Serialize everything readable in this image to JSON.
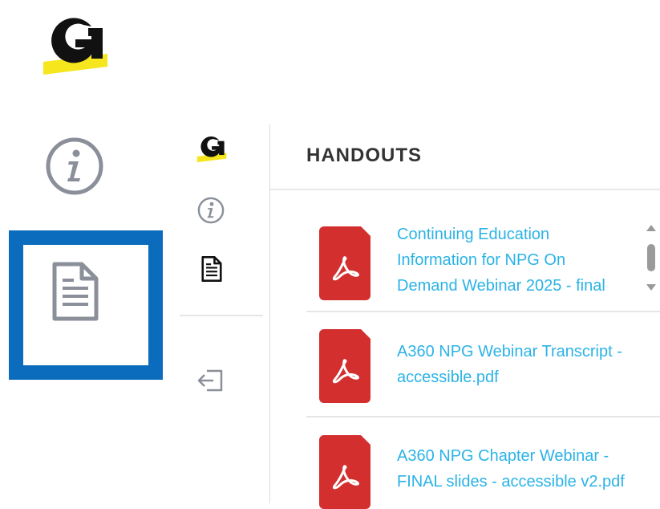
{
  "app": {
    "logo_letter": "G"
  },
  "sidebar": {
    "items": [
      {
        "name": "info",
        "icon": "info-icon"
      },
      {
        "name": "handouts",
        "icon": "document-icon",
        "selected": true
      }
    ],
    "highlight_color": "#0b6bbd"
  },
  "mini_nav": {
    "items": [
      {
        "icon": "logo"
      },
      {
        "icon": "info-icon"
      },
      {
        "icon": "document-icon"
      },
      {
        "icon": "exit-icon"
      }
    ]
  },
  "panel": {
    "title": "HANDOUTS",
    "handouts": [
      {
        "lines": [
          "Continuing Education",
          "Information for NPG On",
          "Demand Webinar 2025 - final"
        ],
        "icon": "pdf-icon"
      },
      {
        "lines": [
          "A360 NPG Webinar Transcript -",
          "accessible.pdf"
        ],
        "icon": "pdf-icon"
      },
      {
        "lines": [
          "A360 NPG Chapter Webinar -",
          "FINAL slides - accessible v2.pdf"
        ],
        "icon": "pdf-icon"
      }
    ]
  },
  "colors": {
    "link": "#2bb3e6",
    "pdf": "#d32f2f",
    "logo_underline": "#f5e61e"
  }
}
